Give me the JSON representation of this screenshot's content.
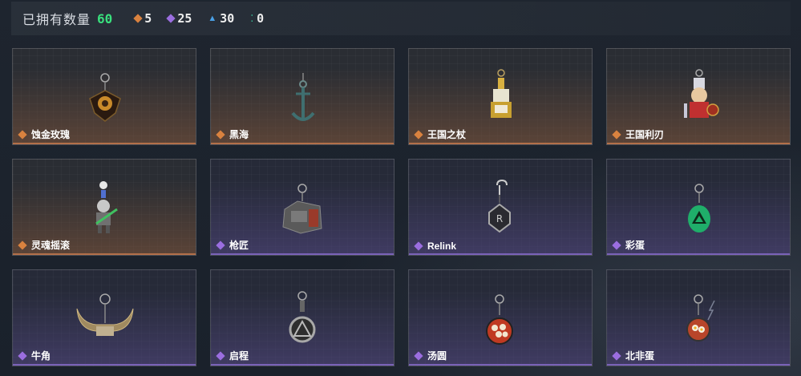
{
  "header": {
    "owned_label": "已拥有数量",
    "owned_count": "60",
    "stats": [
      {
        "icon": "orange-rarity-icon",
        "value": "5",
        "color": "#d9823f"
      },
      {
        "icon": "purple-rarity-icon",
        "value": "25",
        "color": "#9b6ee0"
      },
      {
        "icon": "blue-rarity-icon",
        "value": "30",
        "color": "#4aa0e6"
      },
      {
        "icon": "green-rarity-icon",
        "value": "0",
        "color": "#3ad0a5"
      }
    ]
  },
  "items": [
    {
      "name": "蚀金玫瑰",
      "rarity": "orange",
      "icon": "rose-charm-icon"
    },
    {
      "name": "黑海",
      "rarity": "orange",
      "icon": "anchor-charm-icon"
    },
    {
      "name": "王国之杖",
      "rarity": "orange",
      "icon": "scepter-charm-icon"
    },
    {
      "name": "王国利刃",
      "rarity": "orange",
      "icon": "knight-charm-icon"
    },
    {
      "name": "灵魂摇滚",
      "rarity": "orange",
      "icon": "skeleton-guitar-charm-icon"
    },
    {
      "name": "枪匠",
      "rarity": "purple",
      "icon": "gun-case-charm-icon"
    },
    {
      "name": "Relink",
      "rarity": "purple",
      "icon": "relink-charm-icon"
    },
    {
      "name": "彩蛋",
      "rarity": "purple",
      "icon": "easter-egg-charm-icon"
    },
    {
      "name": "牛角",
      "rarity": "purple",
      "icon": "horns-charm-icon"
    },
    {
      "name": "启程",
      "rarity": "purple",
      "icon": "compass-charm-icon"
    },
    {
      "name": "汤圆",
      "rarity": "purple",
      "icon": "tangyuan-charm-icon"
    },
    {
      "name": "北非蛋",
      "rarity": "purple",
      "icon": "shakshuka-charm-icon"
    }
  ]
}
